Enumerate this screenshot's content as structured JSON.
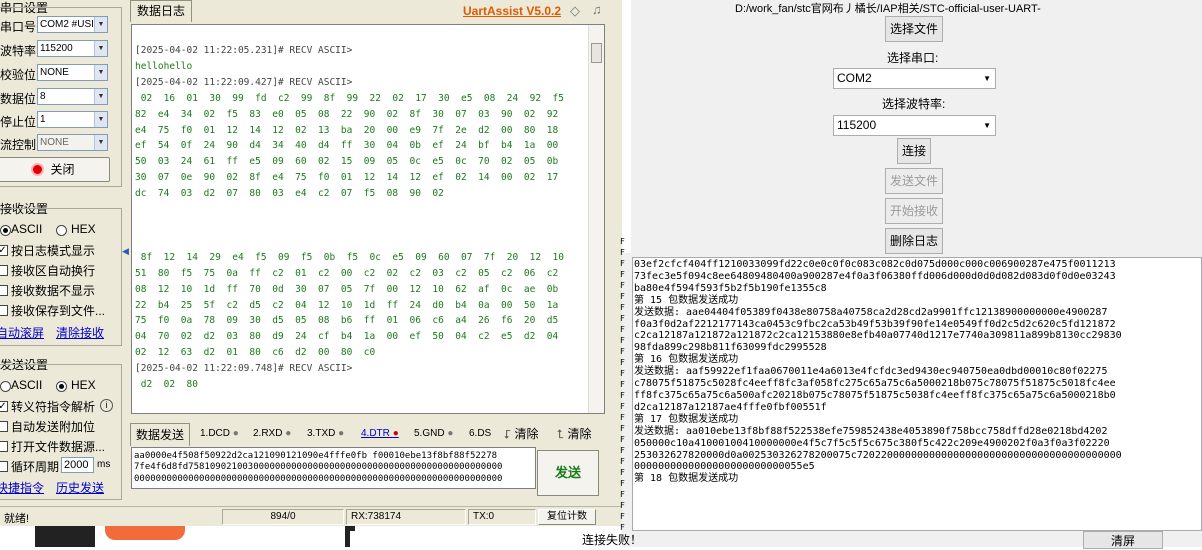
{
  "left": {
    "serial_group_title": "串口设置",
    "labels": {
      "port": "串口号",
      "baud": "波特率",
      "parity": "校验位",
      "databits": "数据位",
      "stopbits": "停止位",
      "flow": "流控制"
    },
    "values": {
      "port": "COM2 #USI",
      "baud": "115200",
      "parity": "NONE",
      "databits": "8",
      "stopbits": "1",
      "flow": "NONE"
    },
    "close_btn": "关闭",
    "recv_group_title": "接收设置",
    "recv_ascii": "ASCII",
    "recv_hex": "HEX",
    "recv_opts": [
      "按日志模式显示",
      "接收区自动换行",
      "接收数据不显示",
      "接收保存到文件..."
    ],
    "recv_links": [
      "自动滚屏",
      "清除接收"
    ],
    "send_group_title": "发送设置",
    "send_ascii": "ASCII",
    "send_hex": "HEX",
    "send_opts": [
      "转义符指令解析",
      "自动发送附加位",
      "打开文件数据源...",
      "循环周期"
    ],
    "cycle_value": "2000",
    "cycle_unit": "ms",
    "send_links": [
      "快捷指令",
      "历史发送"
    ],
    "log_tab": "数据日志",
    "brand": "UartAssist V5.0.2",
    "log_lines": [
      {
        "ts": "[2025-04-02 11:22:05.231]# RECV ASCII>"
      },
      {
        "d": "hellohello"
      },
      {
        "ts": "[2025-04-02 11:22:09.427]# RECV ASCII>"
      },
      {
        "d": " 02  16  01  30  99  fd  c2  99  8f  99  22  02  17  30  e5  08  24  92  f5"
      },
      {
        "d": "82  e4  34  02  f5  83  e0  05  08  22  90  02  8f  30  07  03  90  02  92"
      },
      {
        "d": "e4  75  f0  01  12  14  12  02  13  ba  20  00  e9  7f  2e  d2  00  80  18"
      },
      {
        "d": "ef  54  0f  24  90  d4  34  40  d4  ff  30  04  0b  ef  24  bf  b4  1a  00"
      },
      {
        "d": "50  03  24  61  ff  e5  09  60  02  15  09  05  0c  e5  0c  70  02  05  0b"
      },
      {
        "d": "30  07  0e  90  02  8f  e4  75  f0  01  12  14  12  ef  02  14  00  02  17"
      },
      {
        "d": "dc  74  03  d2  07  80  03  e4  c2  07  f5  08  90  02"
      },
      {
        "d": ""
      },
      {
        "d": ""
      },
      {
        "d": ""
      },
      {
        "d": " 8f  12  14  29  e4  f5  09  f5  0b  f5  0c  e5  09  60  07  7f  20  12  10"
      },
      {
        "d": "51  80  f5  75  0a  ff  c2  01  c2  00  c2  02  c2  03  c2  05  c2  06  c2"
      },
      {
        "d": "08  12  10  1d  ff  70  0d  30  07  05  7f  00  12  10  62  af  0c  ae  0b"
      },
      {
        "d": "22  b4  25  5f  c2  d5  c2  04  12  10  1d  ff  24  d0  b4  0a  00  50  1a"
      },
      {
        "d": "75  f0  0a  78  09  30  d5  05  08  b6  ff  01  06  c6  a4  26  f6  20  d5"
      },
      {
        "d": "04  70  02  d2  03  80  d9  24  cf  b4  1a  00  ef  50  04  c2  e5  d2  04"
      },
      {
        "d": "02  12  63  d2  01  80  c6  d2  00  80  c0"
      },
      {
        "ts": "[2025-04-02 11:22:09.748]# RECV ASCII>"
      },
      {
        "d": " d2  02  80"
      }
    ],
    "send_tab": "数据发送",
    "pins": [
      "1.DCD",
      "2.RXD",
      "3.TXD",
      "4.DTR",
      "5.GND",
      "6.DS"
    ],
    "clear_label": "清除",
    "clear_label2": "清除",
    "send_text": "aa0000e4f508f50922d2ca121090121090e4fffe0fb f00010ebe13f8bf88f52278\n7fe4f6d8fd7581090210030000000000000000000000000000000000000000000000\n00000000000000000000000000000000000000000000000000000000000000000000",
    "send_btn": "发送",
    "status": {
      "ready": "就绪!",
      "count": "894/0",
      "rx": "RX:738174",
      "tx": "TX:0",
      "reset": "复位计数"
    }
  },
  "right": {
    "path": "D:/work_fan/stc官网布丿橘长/IAP相关/STC-official-user-UART-",
    "choose_file": "选择文件",
    "port_label": "选择串口:",
    "port_value": "COM2",
    "baud_label": "选择波特率:",
    "baud_value": "115200",
    "connect": "连接",
    "send_file": "发送文件",
    "start_recv": "开始接收",
    "delete_log": "删除日志",
    "log": "03ef2cfcf404ff1210033099fd22c0e0c0f0c083c082c0d075d000c000c006900287e475f0011213\n73fec3e5f094c8ee64809480400a900287e4f0a3f06380ffd006d000d0d0d082d083d0f0d0e03243\nba80e4f594f593f5b2f5b190fe1355c8\n第 15 包数据发送成功\n发送数据: aae04404f05389f0438e80758a40758ca2d28cd2a9901ffc12138900000000e4900287\nf0a3f0d2af2212177143ca0453c9fbc2ca53b49f53b39f90fe14e0549ff0d2c5d2c620c5fd121872\nc2ca12187a121872a121872c2ca12153880e8efb40a07740d1217e7740a309811a899b8130cc29830\n98fda899c298b811f63099fdc2995528\n第 16 包数据发送成功\n发送数据: aaf59922ef1faa0670011e4a6013e4fcfdc3ed9430ec940750ea0dbd00010c80f02275\nc78075f51875c5028fc4eeff8fc3af058fc275c65a75c6a5000218b075c78075f51875c5018fc4ee\nff8fc375c65a75c6a500afc20218b075c78075f51875c5038fc4eeff8fc375c65a75c6a5000218b0\nd2ca12187a12187ae4fffe0fbf00551f\n第 17 包数据发送成功\n发送数据: aa010ebe13f8bf88f522538efe759852438e4053890f758bcc758dffd28e0218bd4202\n050000c10a41000100410000000e4f5c7f5c5f5c675c380f5c422c209e4900202f0a3f0a3f02220\n253032627820000d0a002530326278200075c72022000000000000000000000000000000000000000\n0000000000000000000000000055e5\n第 18 包数据发送成功",
    "conn_fail": "连接失败！",
    "clear": "清屏"
  }
}
